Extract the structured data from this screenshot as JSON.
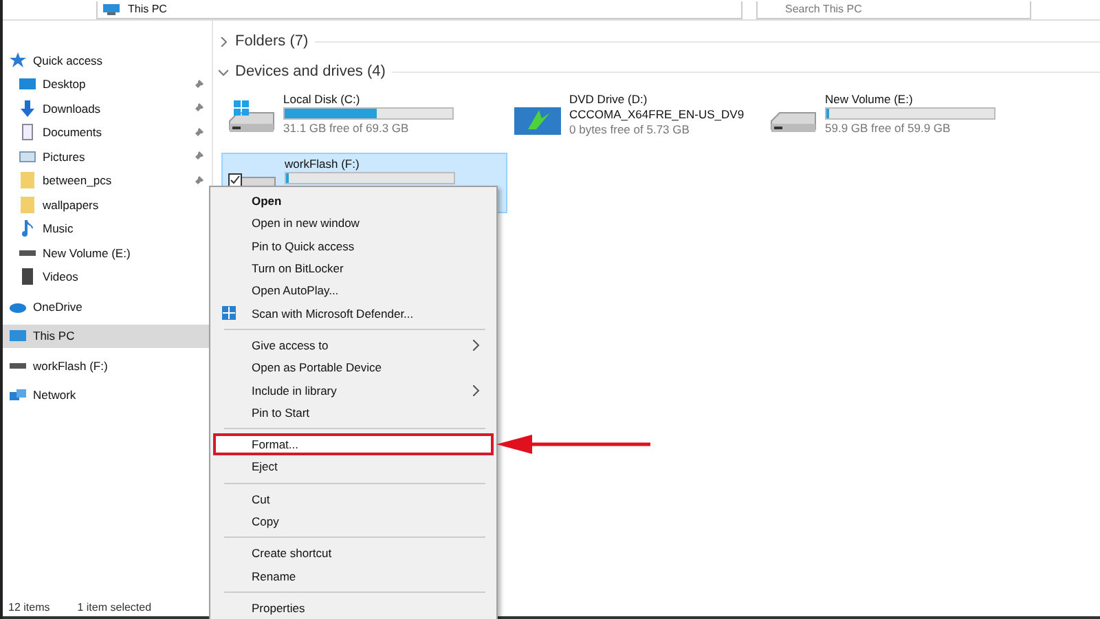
{
  "address_bar": {
    "location": "This PC"
  },
  "search": {
    "placeholder": "Search This PC"
  },
  "sidebar": {
    "items": [
      {
        "label": "Quick access",
        "selected": false,
        "children": [
          {
            "label": "Desktop",
            "pinned": true,
            "selected": false
          },
          {
            "label": "Downloads",
            "pinned": true,
            "selected": false
          },
          {
            "label": "Documents",
            "pinned": true,
            "selected": false
          },
          {
            "label": "Pictures",
            "pinned": true,
            "selected": false
          },
          {
            "label": "between_pcs",
            "pinned": true,
            "selected": false
          },
          {
            "label": "wallpapers",
            "pinned": false,
            "selected": false
          },
          {
            "label": "Music",
            "pinned": false,
            "selected": false
          },
          {
            "label": "New Volume (E:)",
            "pinned": false,
            "selected": false
          },
          {
            "label": "Videos",
            "pinned": false,
            "selected": false
          }
        ]
      },
      {
        "label": "OneDrive",
        "selected": false
      },
      {
        "label": "This PC",
        "selected": true
      },
      {
        "label": "workFlash (F:)",
        "selected": false
      },
      {
        "label": "Network",
        "selected": false
      }
    ]
  },
  "sections": [
    {
      "title": "Folders (7)",
      "expanded": false
    },
    {
      "title": "Devices and drives (4)",
      "expanded": true
    }
  ],
  "drives": [
    {
      "name": "Local Disk (C:)",
      "kind": "system",
      "level": 0.55,
      "free": "31.1 GB free of 69.3 GB",
      "selected": false,
      "checked": false
    },
    {
      "name": "DVD Drive (D:)",
      "kind": "dvd",
      "label": "CCCOMA_X64FRE_EN-US_DV9",
      "free": "0 bytes free of 5.73 GB",
      "selected": false,
      "checked": false
    },
    {
      "name": "New Volume (E:)",
      "kind": "disk",
      "level": 0.0,
      "free": "59.9 GB free of 59.9 GB",
      "selected": false,
      "checked": false
    },
    {
      "name": "workFlash (F:)",
      "kind": "disk",
      "level": 0.0,
      "selected": true,
      "checked": true
    }
  ],
  "context_menu": {
    "groups": [
      [
        {
          "label": "Open",
          "bold": true
        },
        {
          "label": "Open in new window"
        },
        {
          "label": "Pin to Quick access"
        },
        {
          "label": "Turn on BitLocker"
        },
        {
          "label": "Open AutoPlay..."
        },
        {
          "label": "Scan with Microsoft Defender..."
        }
      ],
      [
        {
          "label": "Give access to",
          "submenu": true
        },
        {
          "label": "Open as Portable Device"
        },
        {
          "label": "Include in library",
          "submenu": true
        },
        {
          "label": "Pin to Start"
        }
      ],
      [
        {
          "label": "Format...",
          "annotated": true
        },
        {
          "label": "Eject"
        }
      ],
      [
        {
          "label": "Cut"
        },
        {
          "label": "Copy"
        }
      ],
      [
        {
          "label": "Create shortcut"
        },
        {
          "label": "Rename"
        }
      ],
      [
        {
          "label": "Properties"
        }
      ]
    ]
  },
  "status_bar": {
    "item_count": "12 items",
    "selection": "1 item selected"
  }
}
